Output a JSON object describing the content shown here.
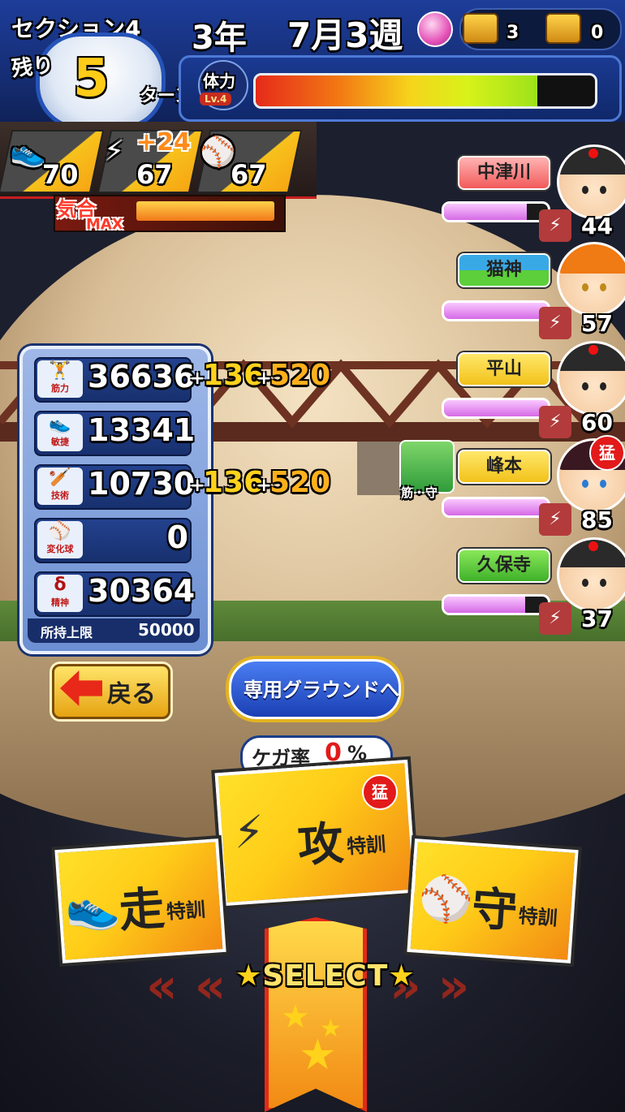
{
  "header": {
    "section_label": "セクション4",
    "remain_label": "残り",
    "turns_left": "5",
    "turn_label": "ターン",
    "year": "3年",
    "date": "7月3週",
    "chest_gold_count": "3",
    "chest_wood_count": "0"
  },
  "stamina": {
    "label": "体力",
    "level": "Lv.4",
    "fill_fraction": 0.83
  },
  "practice_levels": {
    "items": [
      {
        "icon": "running-shoe-icon",
        "value": "70"
      },
      {
        "icon": "batting-icon",
        "value": "67",
        "bonus": "+24"
      },
      {
        "icon": "glove-icon",
        "value": "67"
      }
    ]
  },
  "spirit": {
    "label": "気合",
    "status": "MAX"
  },
  "stats": {
    "rows": [
      {
        "label": "筋力",
        "value": "36636",
        "gain1": "136",
        "gain2": "520"
      },
      {
        "label": "敏捷",
        "value": "13341"
      },
      {
        "label": "技術",
        "value": "10730",
        "gain1": "136",
        "gain2": "520"
      },
      {
        "label": "変化球",
        "value": "0"
      },
      {
        "label": "精神",
        "value": "30364"
      }
    ],
    "cap_label": "所持上限",
    "cap_value": "50000",
    "plus": "+"
  },
  "hint": {
    "text": "筋・守"
  },
  "support_characters": [
    {
      "name": "中津川",
      "bond": "44",
      "bond_fraction": 0.8,
      "plate_color": "#f77a7a"
    },
    {
      "name": "猫神",
      "bond": "57",
      "bond_fraction": 1.0,
      "plate_color": "#39a9e6"
    },
    {
      "name": "平山",
      "bond": "60",
      "bond_fraction": 1.0,
      "plate_color": "#ffd21c"
    },
    {
      "name": "峰本",
      "bond": "85",
      "bond_fraction": 1.0,
      "plate_color": "#ffd21c",
      "badge": "猛"
    },
    {
      "name": "久保寺",
      "bond": "37",
      "bond_fraction": 0.78,
      "plate_color": "#6cd64a"
    }
  ],
  "buttons": {
    "back": "戻る",
    "ground": "専用グラウンドへ"
  },
  "injury": {
    "label": "ケガ率",
    "value": "0",
    "unit": "%"
  },
  "training": {
    "attack_main": "攻",
    "attack_sub": "特訓",
    "attack_badge": "猛",
    "run_main": "走",
    "run_sub": "特訓",
    "defense_main": "守",
    "defense_sub": "特訓"
  },
  "select_label": "SELECT",
  "colors": {
    "header_blue": "#1d3d9a",
    "accent_yellow": "#ffd21c",
    "accent_red": "#e21a1a"
  }
}
